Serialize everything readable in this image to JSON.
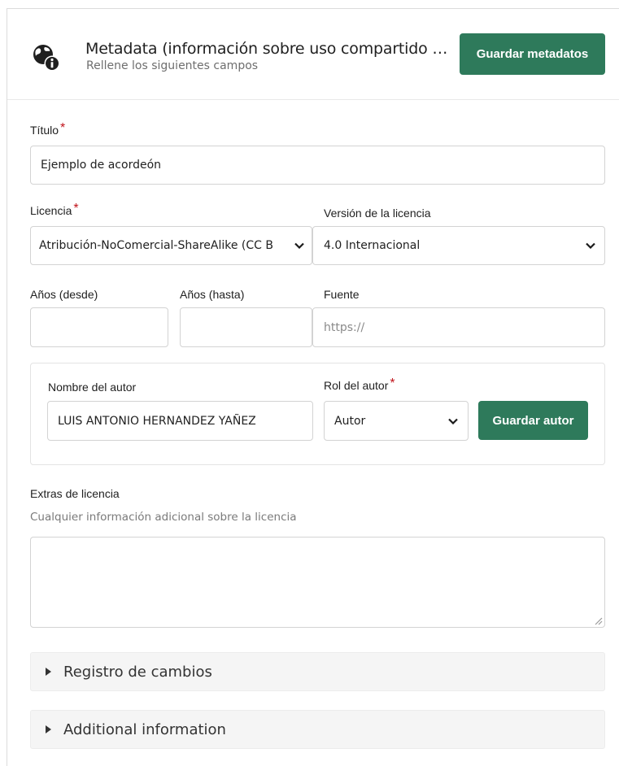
{
  "header": {
    "icon": "globe-info-icon",
    "title": "Metadata (información sobre uso compartido y li...",
    "subtitle": "Rellene los siguientes campos",
    "save_label": "Guardar metadatos"
  },
  "form": {
    "title": {
      "label": "Título",
      "required_mark": "*",
      "value": "Ejemplo de acordeón"
    },
    "license": {
      "label": "Licencia",
      "required_mark": "*",
      "value": "Atribución-NoComercial-ShareAlike (CC B"
    },
    "license_version": {
      "label": "Versión de la licencia",
      "value": "4.0 Internacional"
    },
    "years_from": {
      "label": "Años (desde)",
      "value": ""
    },
    "years_to": {
      "label": "Años (hasta)",
      "value": ""
    },
    "source": {
      "label": "Fuente",
      "placeholder": "https://"
    },
    "author": {
      "name_label": "Nombre del autor",
      "name_value": "LUIS ANTONIO HERNANDEZ YAÑEZ",
      "role_label": "Rol del autor",
      "role_required_mark": "*",
      "role_value": "Autor",
      "save_label": "Guardar autor"
    },
    "extras": {
      "label": "Extras de licencia",
      "help": "Cualquier información adicional sobre la licencia",
      "value": ""
    }
  },
  "accordions": [
    {
      "label": "Registro de cambios"
    },
    {
      "label": "Additional information"
    }
  ],
  "colors": {
    "primary": "#2e7a5b",
    "required": "#c0131a"
  }
}
